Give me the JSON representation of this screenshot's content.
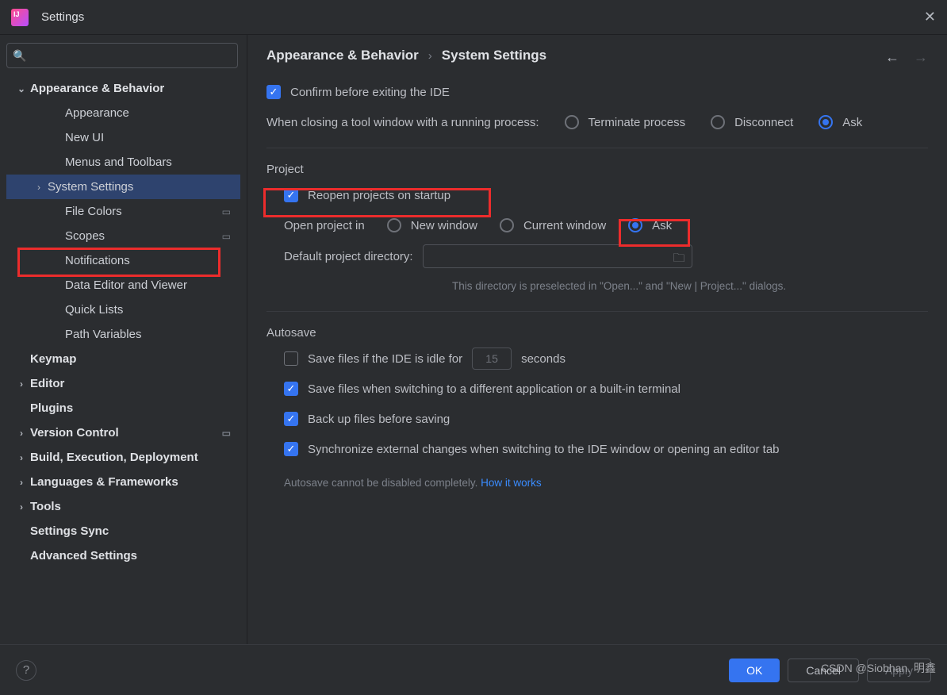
{
  "window": {
    "title": "Settings"
  },
  "search": {
    "placeholder": ""
  },
  "sidebar": {
    "items": [
      {
        "label": "Appearance & Behavior",
        "cat": true,
        "arrow": "down",
        "indent": 0
      },
      {
        "label": "Appearance",
        "indent": 2
      },
      {
        "label": "New UI",
        "indent": 2
      },
      {
        "label": "Menus and Toolbars",
        "indent": 2
      },
      {
        "label": "System Settings",
        "arrow": "right",
        "indent": 1,
        "selected": true
      },
      {
        "label": "File Colors",
        "indent": 2,
        "proj": true
      },
      {
        "label": "Scopes",
        "indent": 2,
        "proj": true
      },
      {
        "label": "Notifications",
        "indent": 2
      },
      {
        "label": "Data Editor and Viewer",
        "indent": 2
      },
      {
        "label": "Quick Lists",
        "indent": 2
      },
      {
        "label": "Path Variables",
        "indent": 2
      },
      {
        "label": "Keymap",
        "cat": true,
        "indent": 0,
        "arrow": "none"
      },
      {
        "label": "Editor",
        "cat": true,
        "arrow": "right",
        "indent": 0
      },
      {
        "label": "Plugins",
        "cat": true,
        "indent": 0,
        "arrow": "none"
      },
      {
        "label": "Version Control",
        "cat": true,
        "arrow": "right",
        "indent": 0,
        "proj": true
      },
      {
        "label": "Build, Execution, Deployment",
        "cat": true,
        "arrow": "right",
        "indent": 0
      },
      {
        "label": "Languages & Frameworks",
        "cat": true,
        "arrow": "right",
        "indent": 0
      },
      {
        "label": "Tools",
        "cat": true,
        "arrow": "right",
        "indent": 0
      },
      {
        "label": "Settings Sync",
        "cat": true,
        "indent": 0,
        "arrow": "none"
      },
      {
        "label": "Advanced Settings",
        "cat": true,
        "indent": 0,
        "arrow": "none"
      }
    ]
  },
  "breadcrumb": {
    "a": "Appearance & Behavior",
    "b": "System Settings"
  },
  "content": {
    "confirm_exit": "Confirm before exiting the IDE",
    "close_tool_label": "When closing a tool window with a running process:",
    "close_opts": {
      "terminate": "Terminate process",
      "disconnect": "Disconnect",
      "ask": "Ask"
    },
    "project_title": "Project",
    "reopen": "Reopen projects on startup",
    "open_in_label": "Open project in",
    "open_opts": {
      "new_window": "New window",
      "current": "Current window",
      "ask": "Ask"
    },
    "default_dir_label": "Default project directory:",
    "default_dir_hint": "This directory is preselected in \"Open...\" and \"New | Project...\" dialogs.",
    "autosave_title": "Autosave",
    "idle_prefix": "Save files if the IDE is idle for",
    "idle_value": "15",
    "idle_suffix": "seconds",
    "save_switch": "Save files when switching to a different application or a built-in terminal",
    "backup": "Back up files before saving",
    "sync": "Synchronize external changes when switching to the IDE window or opening an editor tab",
    "autosave_hint": "Autosave cannot be disabled completely. ",
    "autosave_link": "How it works"
  },
  "footer": {
    "ok": "OK",
    "cancel": "Cancel",
    "apply": "Apply"
  },
  "watermark": "CSDN @Siobhan. 明鑫"
}
